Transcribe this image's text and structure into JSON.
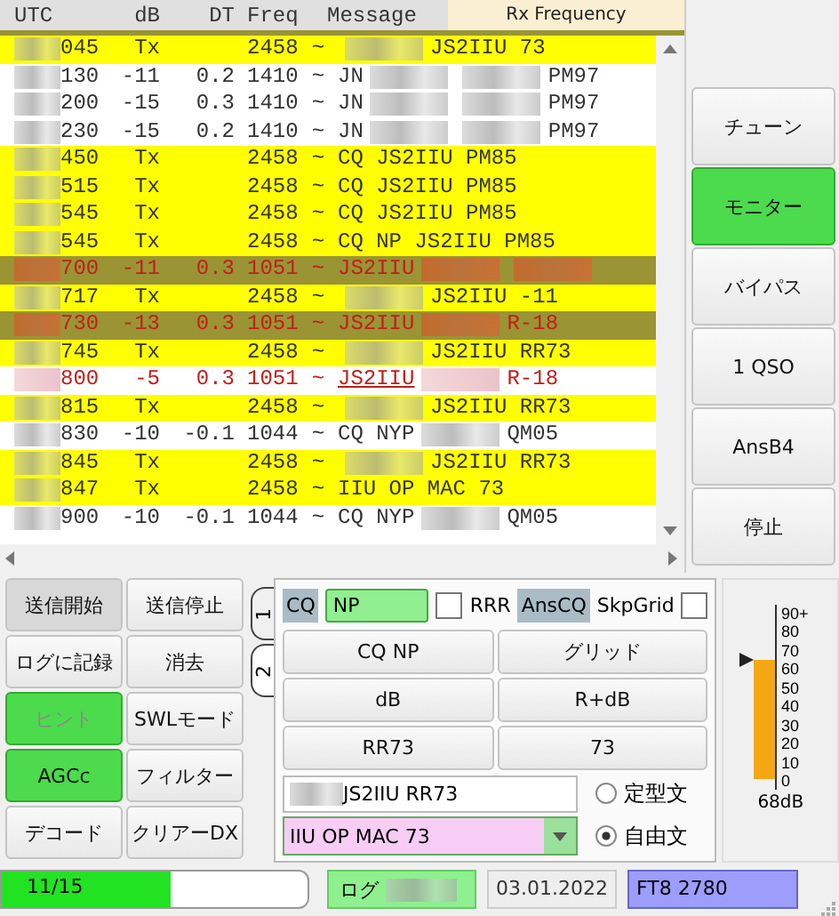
{
  "table": {
    "columns": [
      {
        "label": "UTC",
        "kind": "utc"
      },
      {
        "label": "dB",
        "kind": "db"
      },
      {
        "label": "DT",
        "kind": "dt"
      },
      {
        "label": "Freq",
        "kind": "freq"
      },
      {
        "label": "Message",
        "kind": "msg"
      }
    ],
    "rx_frequency": "Rx Frequency",
    "rows": [
      {
        "kind": "tx",
        "utc": "045",
        "db": "Tx",
        "dt": "",
        "freq": "2458",
        "sep": "~",
        "message": [
          {
            "kind": "redacted"
          },
          {
            "kind": "text",
            "text": "JS2IIU 73"
          }
        ]
      },
      {
        "kind": "rx",
        "utc": "130",
        "db": "-11",
        "dt": "0.2",
        "freq": "1410",
        "sep": "~",
        "message": [
          {
            "kind": "text",
            "text": "JN"
          },
          {
            "kind": "redacted"
          },
          {
            "kind": "redacted"
          },
          {
            "kind": "text",
            "text": "PM97"
          }
        ]
      },
      {
        "kind": "rx",
        "utc": "200",
        "db": "-15",
        "dt": "0.3",
        "freq": "1410",
        "sep": "~",
        "message": [
          {
            "kind": "text",
            "text": "JN"
          },
          {
            "kind": "redacted"
          },
          {
            "kind": "redacted"
          },
          {
            "kind": "text",
            "text": "PM97"
          }
        ]
      },
      {
        "kind": "rx",
        "utc": "230",
        "db": "-15",
        "dt": "0.2",
        "freq": "1410",
        "sep": "~",
        "message": [
          {
            "kind": "text",
            "text": "JN"
          },
          {
            "kind": "redacted"
          },
          {
            "kind": "redacted"
          },
          {
            "kind": "text",
            "text": "PM97"
          }
        ]
      },
      {
        "kind": "tx",
        "utc": "450",
        "db": "Tx",
        "dt": "",
        "freq": "2458",
        "sep": "~",
        "message": [
          {
            "kind": "text",
            "text": "CQ JS2IIU PM85"
          }
        ]
      },
      {
        "kind": "tx",
        "utc": "515",
        "db": "Tx",
        "dt": "",
        "freq": "2458",
        "sep": "~",
        "message": [
          {
            "kind": "text",
            "text": "CQ JS2IIU PM85"
          }
        ]
      },
      {
        "kind": "tx",
        "utc": "545",
        "db": "Tx",
        "dt": "",
        "freq": "2458",
        "sep": "~",
        "message": [
          {
            "kind": "text",
            "text": "CQ JS2IIU PM85"
          }
        ]
      },
      {
        "kind": "tx",
        "utc": "545",
        "db": "Tx",
        "dt": "",
        "freq": "2458",
        "sep": "~",
        "message": [
          {
            "kind": "text",
            "text": "CQ NP JS2IIU PM85"
          }
        ]
      },
      {
        "kind": "to_me",
        "utc": "700",
        "db": "-11",
        "dt": "0.3",
        "freq": "1051",
        "sep": "~",
        "message": [
          {
            "kind": "text",
            "text": "JS2IIU"
          },
          {
            "kind": "redacted"
          },
          {
            "kind": "redacted"
          }
        ]
      },
      {
        "kind": "tx",
        "utc": "717",
        "db": "Tx",
        "dt": "",
        "freq": "2458",
        "sep": "~",
        "message": [
          {
            "kind": "redacted"
          },
          {
            "kind": "text",
            "text": "JS2IIU -11"
          }
        ]
      },
      {
        "kind": "to_me",
        "utc": "730",
        "db": "-13",
        "dt": "0.3",
        "freq": "1051",
        "sep": "~",
        "message": [
          {
            "kind": "text",
            "text": "JS2IIU"
          },
          {
            "kind": "redacted"
          },
          {
            "kind": "text",
            "text": "R-18"
          }
        ]
      },
      {
        "kind": "tx",
        "utc": "745",
        "db": "Tx",
        "dt": "",
        "freq": "2458",
        "sep": "~",
        "message": [
          {
            "kind": "redacted"
          },
          {
            "kind": "text",
            "text": "JS2IIU RR73"
          }
        ]
      },
      {
        "kind": "latest",
        "utc": "800",
        "db": "-5",
        "dt": "0.3",
        "freq": "1051",
        "sep": "~",
        "message": [
          {
            "kind": "text",
            "text": "JS2IIU"
          },
          {
            "kind": "redacted"
          },
          {
            "kind": "text",
            "text": "R-18"
          }
        ]
      },
      {
        "kind": "tx",
        "utc": "815",
        "db": "Tx",
        "dt": "",
        "freq": "2458",
        "sep": "~",
        "message": [
          {
            "kind": "redacted"
          },
          {
            "kind": "text",
            "text": "JS2IIU RR73"
          }
        ]
      },
      {
        "kind": "rx",
        "utc": "830",
        "db": "-10",
        "dt": "-0.1",
        "freq": "1044",
        "sep": "~",
        "message": [
          {
            "kind": "text",
            "text": "CQ NYP"
          },
          {
            "kind": "redacted"
          },
          {
            "kind": "text",
            "text": "QM05"
          }
        ]
      },
      {
        "kind": "tx",
        "utc": "845",
        "db": "Tx",
        "dt": "",
        "freq": "2458",
        "sep": "~",
        "message": [
          {
            "kind": "redacted"
          },
          {
            "kind": "text",
            "text": "JS2IIU RR73"
          }
        ]
      },
      {
        "kind": "tx",
        "utc": "847",
        "db": "Tx",
        "dt": "",
        "freq": "2458",
        "sep": "~",
        "message": [
          {
            "kind": "text",
            "text": "IIU OP MAC 73"
          }
        ]
      },
      {
        "kind": "rx",
        "utc": "900",
        "db": "-10",
        "dt": "-0.1",
        "freq": "1044",
        "sep": "~",
        "message": [
          {
            "kind": "text",
            "text": "CQ NYP"
          },
          {
            "kind": "redacted"
          },
          {
            "kind": "text",
            "text": "QM05"
          }
        ]
      }
    ]
  },
  "side_buttons": [
    {
      "label": "チューン",
      "on": false
    },
    {
      "label": "モニター",
      "on": true
    },
    {
      "label": "バイパス",
      "on": false
    },
    {
      "label": "1 QSO",
      "on": false
    },
    {
      "label": "AnsB4",
      "on": false
    },
    {
      "label": "停止",
      "on": false
    }
  ],
  "control_buttons": [
    {
      "label": "送信開始",
      "on": false,
      "pressed": true,
      "disabled": false
    },
    {
      "label": "送信停止",
      "on": false,
      "pressed": false,
      "disabled": false
    },
    {
      "label": "ログに記録",
      "on": false,
      "pressed": false,
      "disabled": false
    },
    {
      "label": "消去",
      "on": false,
      "pressed": false,
      "disabled": false
    },
    {
      "label": "ヒント",
      "on": true,
      "pressed": false,
      "disabled": true
    },
    {
      "label": "SWLモード",
      "on": false,
      "pressed": false,
      "disabled": false
    },
    {
      "label": "AGCc",
      "on": true,
      "pressed": false,
      "disabled": false
    },
    {
      "label": "フィルター",
      "on": false,
      "pressed": false,
      "disabled": false
    },
    {
      "label": "デコード",
      "on": false,
      "pressed": false,
      "disabled": false
    },
    {
      "label": "クリアーDX",
      "on": false,
      "pressed": false,
      "disabled": false
    }
  ],
  "tabs": [
    {
      "label": "1",
      "selected": false
    },
    {
      "label": "2",
      "selected": true
    }
  ],
  "tab_panel": {
    "options": [
      {
        "kind": "label",
        "text": "CQ"
      },
      {
        "kind": "field",
        "value": "NP"
      },
      {
        "kind": "checkbox_left",
        "label": "RRR",
        "checked": false
      },
      {
        "kind": "label",
        "text": "AnsCQ"
      },
      {
        "kind": "checkbox_right",
        "label": "SkpGrid",
        "checked": false
      }
    ],
    "buttons": [
      "CQ NP",
      "グリッド",
      "dB",
      "R+dB",
      "RR73",
      "73"
    ],
    "fixed_message": {
      "text": "JS2IIU RR73",
      "radio_label": "定型文",
      "selected": false
    },
    "free_message": {
      "value": "IIU OP MAC 73",
      "radio_label": "自由文",
      "selected": true
    }
  },
  "meter": {
    "ticks": [
      "90+",
      "80",
      "70",
      "60",
      "50",
      "40",
      "30",
      "20",
      "10",
      "0"
    ],
    "level": 0.756,
    "reading": "68dB"
  },
  "status_bar": {
    "progress": {
      "text": "11/15",
      "level": 0.55
    },
    "log": "ログ",
    "date": "03.01.2022",
    "mode": "FT8  2780"
  }
}
